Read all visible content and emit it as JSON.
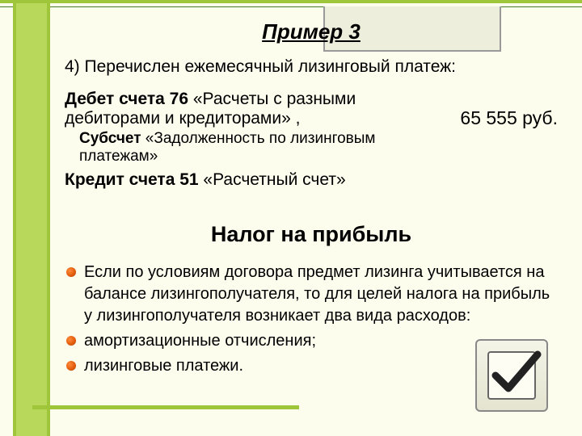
{
  "title": "Пример 3",
  "subtitle": "4) Перечислен ежемесячный лизинговый платеж:",
  "entry": {
    "debit_label": "Дебет счета 76",
    "debit_text": " «Расчеты с разными дебиторами и кредиторами» ,",
    "subaccount_label": "Субсчет",
    "subaccount_text": " «Задолженность по лизинговым платежам»",
    "credit_label": "Кредит счета 51",
    "credit_text": " «Расчетный счет»",
    "amount": "65 555 руб."
  },
  "section_title": "Налог на прибыль",
  "bullets": [
    "Если по условиям договора предмет лизинга учитывается на балансе лизингополучателя, то для целей налога на прибыль у лизингополучателя возникает два вида расходов:",
    "амортизационные отчисления;",
    "лизинговые платежи."
  ]
}
